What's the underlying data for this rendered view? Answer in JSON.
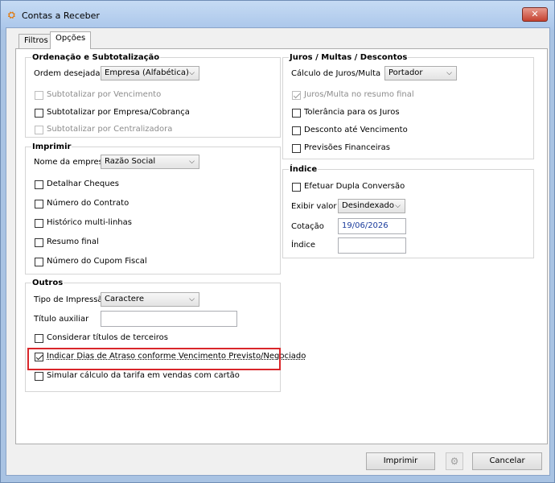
{
  "window": {
    "title": "Contas a Receber",
    "app_icon": "app-icon",
    "close_glyph": "✕"
  },
  "tabs": [
    {
      "label": "Filtros",
      "active": false
    },
    {
      "label": "Opções",
      "active": true
    }
  ],
  "ordenacao": {
    "title": "Ordenação e Subtotalização",
    "ordem_label": "Ordem desejada",
    "ordem_value": "Empresa (Alfabética)",
    "checkboxes": [
      {
        "label": "Subtotalizar por Vencimento",
        "checked": false,
        "enabled": false
      },
      {
        "label": "Subtotalizar por Empresa/Cobrança",
        "checked": false,
        "enabled": true
      },
      {
        "label": "Subtotalizar por Centralizadora",
        "checked": false,
        "enabled": false
      }
    ]
  },
  "imprimir": {
    "title": "Imprimir",
    "nome_label": "Nome da empresa",
    "nome_value": "Razão Social",
    "checkboxes": [
      {
        "label": "Detalhar Cheques",
        "checked": false
      },
      {
        "label": "Número do Contrato",
        "checked": false
      },
      {
        "label": "Histórico multi-linhas",
        "checked": false
      },
      {
        "label": "Resumo final",
        "checked": false
      },
      {
        "label": "Número do Cupom Fiscal",
        "checked": false
      }
    ]
  },
  "outros": {
    "title": "Outros",
    "tipo_label": "Tipo de Impressão",
    "tipo_value": "Caractere",
    "titulo_label": "Título auxiliar",
    "titulo_value": "",
    "checkboxes": [
      {
        "label": "Considerar títulos de terceiros",
        "checked": false
      },
      {
        "label": "Indicar Dias de Atraso conforme Vencimento Previsto/Negociado",
        "checked": true
      },
      {
        "label": "Simular cálculo da tarifa em vendas com cartão",
        "checked": false
      }
    ]
  },
  "juros": {
    "title": "Juros / Multas / Descontos",
    "calculo_label": "Cálculo de Juros/Multa",
    "calculo_value": "Portador",
    "checkboxes": [
      {
        "label": "Juros/Multa no resumo final",
        "checked": true,
        "enabled": false
      },
      {
        "label": "Tolerância para os Juros",
        "checked": false,
        "enabled": true
      },
      {
        "label": "Desconto até Vencimento",
        "checked": false,
        "enabled": true
      },
      {
        "label": "Previsões Financeiras",
        "checked": false,
        "enabled": true
      }
    ]
  },
  "indice": {
    "title": "Índice",
    "efetuar_label": "Efetuar Dupla Conversão",
    "efetuar_checked": false,
    "exibir_label": "Exibir valor",
    "exibir_value": "Desindexado",
    "cotacao_label": "Cotação",
    "cotacao_value": "19/06/2026",
    "indice_label": "Índice",
    "indice_value": ""
  },
  "footer": {
    "imprimir_label": "Imprimir",
    "cancelar_label": "Cancelar",
    "gear_icon": "gear-icon"
  },
  "colors": {
    "highlight": "#d9262a",
    "date_text": "#1a3b9c"
  }
}
